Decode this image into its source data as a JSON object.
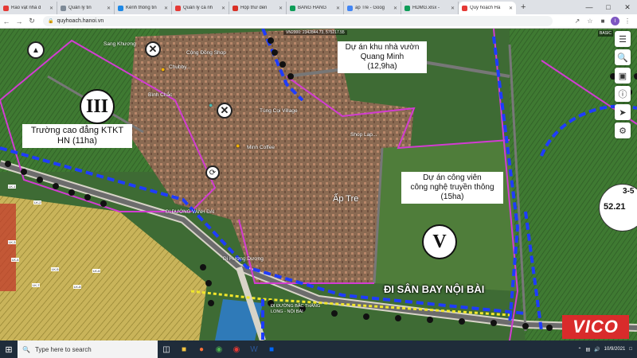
{
  "browser": {
    "tabs": [
      {
        "label": "Rao vặt nhà đ",
        "fav_color": "#e53935"
      },
      {
        "label": "Quản lý tin",
        "fav_color": "#7e8a97"
      },
      {
        "label": "Kênh thông tin",
        "fav_color": "#1e88e5"
      },
      {
        "label": "Quản lý cá nh",
        "fav_color": "#e53935"
      },
      {
        "label": "Hộp thư đến",
        "fav_color": "#d93025"
      },
      {
        "label": "BẢNG HÀNG",
        "fav_color": "#0f9d58"
      },
      {
        "label": "ấp Tre - Goog",
        "fav_color": "#4285f4"
      },
      {
        "label": "HDMG.xlsx -",
        "fav_color": "#0f9d58"
      },
      {
        "label": "Quy hoạch Hà",
        "fav_color": "#e53935",
        "active": true
      }
    ],
    "new_tab": "+",
    "url": "quyhoach.hanoi.vn",
    "avatar_letter": "I"
  },
  "map": {
    "coord_readout": "VN2000: 2342844.73, 575217.55",
    "basic_tag": "BASIC",
    "scale_top": "3-5",
    "scale_value": "52.21",
    "projects": {
      "quang_minh": "Dự án khu nhà vườn Quang Minh (12,9ha)",
      "quang_minh_l1": "Dự án khu nhà vườn",
      "quang_minh_l2": "Quang Minh",
      "quang_minh_l3": "(12,9ha)",
      "college_l1": "Trường cao đẳng KTKT",
      "college_l2": "HN (11ha)",
      "park_l1": "Dự án công viên",
      "park_l2": "công nghệ truyền thông",
      "park_l3": "(15ha)"
    },
    "roman_labels": {
      "iii": "III",
      "v": "V"
    },
    "places": {
      "ap_tre": "Ấp Tre",
      "village": "Tùng Cọi Village",
      "shop": "Shop Lap...",
      "dong_dang": "Cộng Đồng Shop",
      "chubby": "Chubby...",
      "binh_chac": "Bình Chắc",
      "thon": "Sang Khương",
      "minh_coffee": "Minh Coffee",
      "huong_duong": "Đi Hương Dương",
      "vanh_dai": "ĐI ĐƯỜNG VÀNH ĐAI",
      "thang_long": "ĐI ĐƯỜNG BẮC THĂNG LONG - NỘI BÀI"
    },
    "highway_label": "ĐI SÂN BAY NỘI BÀI",
    "brand": "VICO",
    "lots": [
      "LK-1",
      "LK-2",
      "LK-3",
      "LK-4",
      "LK-5",
      "LK-6",
      "LK-7",
      "LK-8"
    ]
  },
  "taskbar": {
    "search_placeholder": "Type here to search",
    "time": "",
    "date": "10/9/2021"
  }
}
